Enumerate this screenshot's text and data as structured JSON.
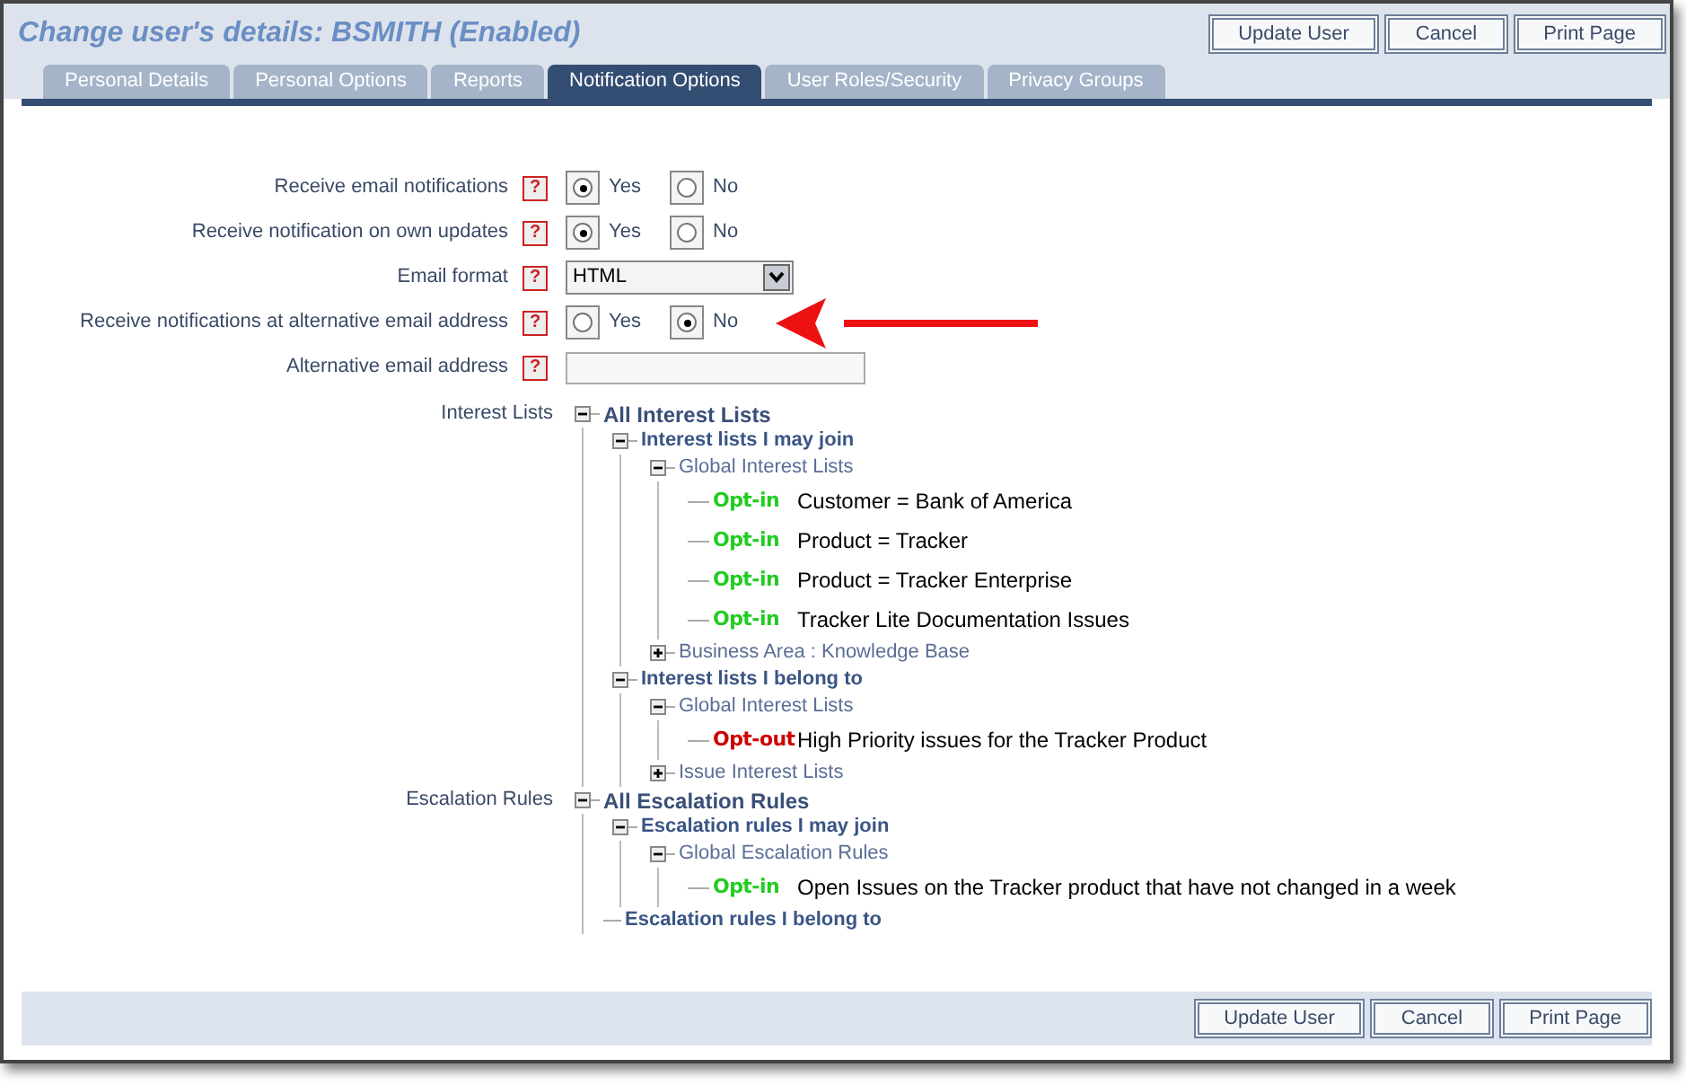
{
  "window": {
    "title": "Change user's details: BSMITH (Enabled)"
  },
  "top_buttons": [
    "Update User",
    "Cancel",
    "Print Page"
  ],
  "bottom_buttons": [
    "Update User",
    "Cancel",
    "Print Page"
  ],
  "tabs": [
    {
      "label": "Personal Details",
      "selected": false
    },
    {
      "label": "Personal Options",
      "selected": false
    },
    {
      "label": "Reports",
      "selected": false
    },
    {
      "label": "Notification Options",
      "selected": true
    },
    {
      "label": "User Roles/Security",
      "selected": false
    },
    {
      "label": "Privacy Groups",
      "selected": false
    }
  ],
  "help_icon": "?",
  "fields": [
    {
      "kind": "radio",
      "label": "Receive email notifications",
      "options": [
        {
          "label": "Yes",
          "selected": true
        },
        {
          "label": "No",
          "selected": false
        }
      ]
    },
    {
      "kind": "radio",
      "label": "Receive notification on own updates",
      "options": [
        {
          "label": "Yes",
          "selected": true
        },
        {
          "label": "No",
          "selected": false
        }
      ]
    },
    {
      "kind": "select",
      "label": "Email format",
      "value": "HTML"
    },
    {
      "kind": "radio",
      "label": "Receive notifications at alternative email address",
      "options": [
        {
          "label": "Yes",
          "selected": false
        },
        {
          "label": "No",
          "selected": true
        }
      ],
      "arrow": true
    },
    {
      "kind": "text",
      "label": "Alternative email address"
    }
  ],
  "trees": [
    {
      "label": "Interest Lists",
      "root": {
        "kind": "group",
        "text": "All Interest Lists",
        "expanded": true,
        "children": [
          {
            "kind": "group",
            "text": "Interest lists I may join",
            "expanded": true,
            "children": [
              {
                "kind": "group",
                "text": "Global Interest Lists",
                "expanded": true,
                "children": [
                  {
                    "kind": "item",
                    "tag": "Opt-in",
                    "color": "#22cc22",
                    "text": "Customer = Bank of America"
                  },
                  {
                    "kind": "item",
                    "tag": "Opt-in",
                    "color": "#22cc22",
                    "text": "Product = Tracker"
                  },
                  {
                    "kind": "item",
                    "tag": "Opt-in",
                    "color": "#22cc22",
                    "text": "Product = Tracker Enterprise"
                  },
                  {
                    "kind": "item",
                    "tag": "Opt-in",
                    "color": "#22cc22",
                    "text": "Tracker Lite Documentation Issues"
                  }
                ]
              },
              {
                "kind": "group",
                "text": "Business Area : Knowledge Base",
                "expanded": false
              }
            ]
          },
          {
            "kind": "group",
            "text": "Interest lists I belong to",
            "expanded": true,
            "children": [
              {
                "kind": "group",
                "text": "Global Interest Lists",
                "expanded": true,
                "children": [
                  {
                    "kind": "item",
                    "tag": "Opt-out",
                    "color": "#cc0000",
                    "text": "High Priority issues for the Tracker Product"
                  }
                ]
              },
              {
                "kind": "group",
                "text": "Issue Interest Lists",
                "expanded": false
              }
            ]
          }
        ]
      }
    },
    {
      "label": "Escalation Rules",
      "root": {
        "kind": "group",
        "text": "All Escalation Rules",
        "expanded": true,
        "children": [
          {
            "kind": "group",
            "text": "Escalation rules I may join",
            "expanded": true,
            "children": [
              {
                "kind": "group",
                "text": "Global Escalation Rules",
                "expanded": true,
                "children": [
                  {
                    "kind": "item",
                    "tag": "Opt-in",
                    "color": "#22cc22",
                    "text": "Open Issues on the Tracker product that have not changed in a week"
                  }
                ]
              }
            ]
          },
          {
            "kind": "plain",
            "text": "Escalation rules I belong to"
          }
        ]
      }
    }
  ]
}
